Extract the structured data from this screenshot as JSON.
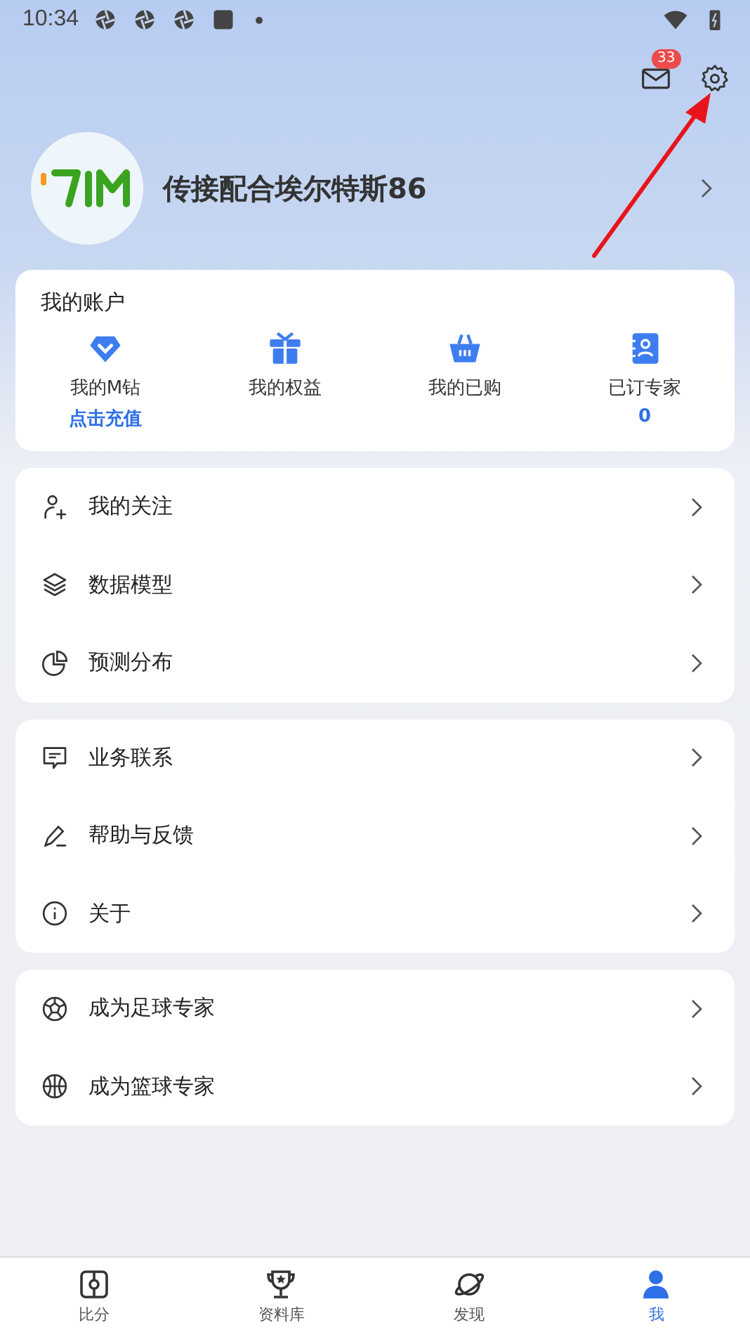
{
  "status_bar": {
    "time": "10:34"
  },
  "header": {
    "mail_badge": "33"
  },
  "profile": {
    "name": "传接配合埃尔特斯86"
  },
  "account": {
    "title": "我的账户",
    "items": [
      {
        "kind": "diamond",
        "label": "我的M钻",
        "sub": "点击充值"
      },
      {
        "kind": "gift",
        "label": "我的权益"
      },
      {
        "kind": "basket",
        "label": "我的已购"
      },
      {
        "kind": "contacts",
        "label": "已订专家",
        "sub": "0"
      }
    ]
  },
  "menu_groups": [
    [
      {
        "kind": "follow",
        "label": "我的关注"
      },
      {
        "kind": "layers",
        "label": "数据模型"
      },
      {
        "kind": "pie",
        "label": "预测分布"
      }
    ],
    [
      {
        "kind": "message",
        "label": "业务联系"
      },
      {
        "kind": "pen",
        "label": "帮助与反馈"
      },
      {
        "kind": "info",
        "label": "关于"
      }
    ],
    [
      {
        "kind": "football",
        "label": "成为足球专家"
      },
      {
        "kind": "basketball",
        "label": "成为篮球专家"
      }
    ]
  ],
  "tab_bar": [
    {
      "kind": "score",
      "label": "比分",
      "selected": false
    },
    {
      "kind": "trophy",
      "label": "资料库",
      "selected": false
    },
    {
      "kind": "planet",
      "label": "发现",
      "selected": false
    },
    {
      "kind": "person",
      "label": "我",
      "selected": true
    }
  ]
}
